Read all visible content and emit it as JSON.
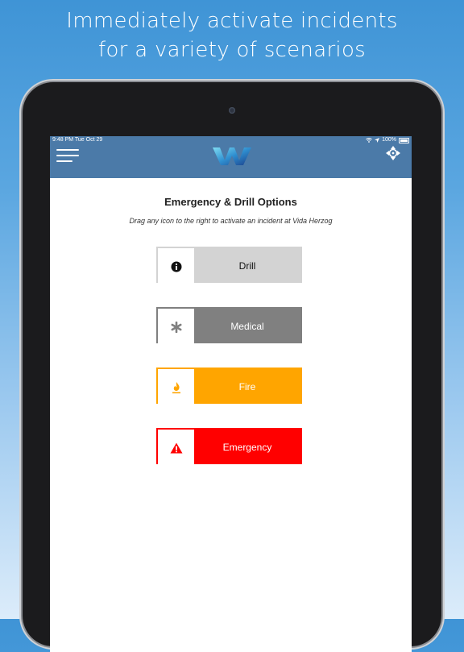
{
  "headline": {
    "line1": "Immediately activate incidents",
    "line2": "for a variety of scenarios"
  },
  "status_bar": {
    "time_date": "9:48 PM  Tue Oct 29",
    "battery": "100%"
  },
  "app_bar": {
    "menu_icon": "hamburger-menu-icon",
    "logo": "w-logo",
    "move_icon": "arrows-move-icon"
  },
  "content": {
    "title": "Emergency & Drill Options",
    "subtitle": "Drag any icon to the right to activate an incident at Vida Herzog"
  },
  "options": [
    {
      "label": "Drill",
      "icon": "info-circle-icon",
      "color": "#d3d3d3",
      "text_color": "#111111"
    },
    {
      "label": "Medical",
      "icon": "asterisk-icon",
      "color": "#808080",
      "text_color": "#ffffff"
    },
    {
      "label": "Fire",
      "icon": "flame-icon",
      "color": "#ffa500",
      "text_color": "#ffffff"
    },
    {
      "label": "Emergency",
      "icon": "warning-triangle-icon",
      "color": "#ff0000",
      "text_color": "#ffffff"
    }
  ]
}
